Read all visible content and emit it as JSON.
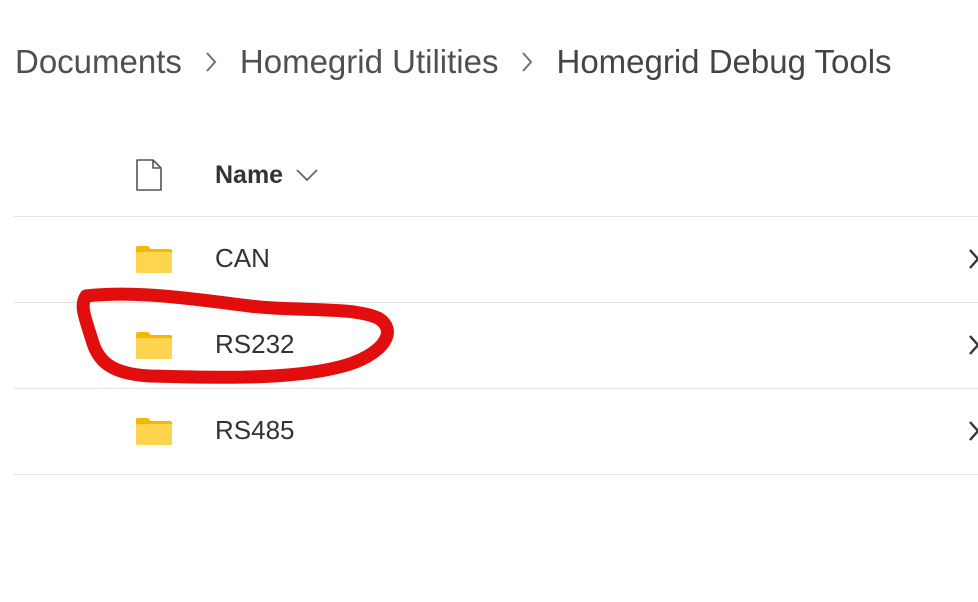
{
  "breadcrumb": {
    "items": [
      {
        "label": "Documents"
      },
      {
        "label": "Homegrid Utilities"
      },
      {
        "label": "Homegrid Debug Tools"
      }
    ],
    "separator_icon": "chevron-right-icon"
  },
  "list_header": {
    "file_type_icon": "document-icon",
    "name_label": "Name",
    "sort_icon": "chevron-down-icon"
  },
  "rows": [
    {
      "label": "CAN",
      "icon": "folder-icon"
    },
    {
      "label": "RS232",
      "icon": "folder-icon"
    },
    {
      "label": "RS485",
      "icon": "folder-icon"
    }
  ],
  "colors": {
    "folder_body": "#FFD54F",
    "folder_tab": "#F5B800",
    "annotation": "#E00000",
    "divider": "#E3E3E3",
    "text": "#333333"
  }
}
